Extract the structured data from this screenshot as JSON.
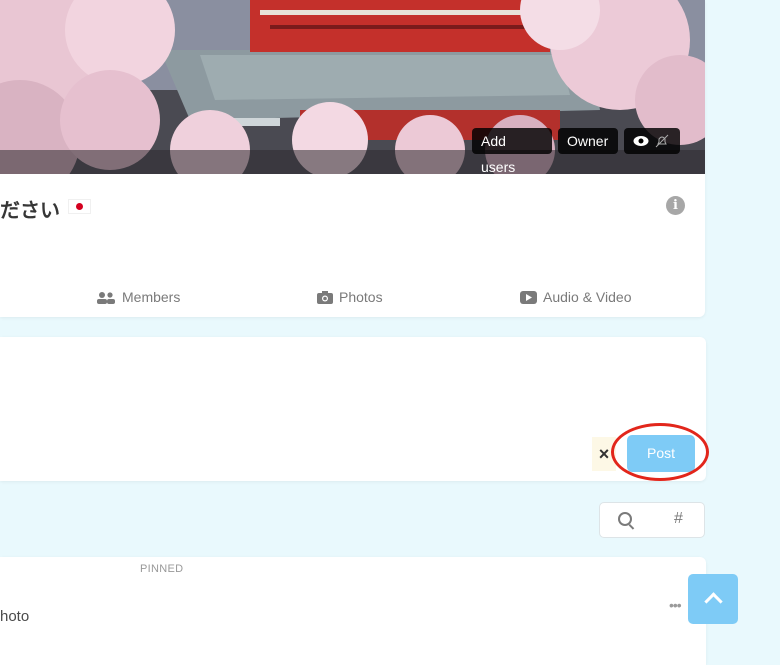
{
  "cover": {
    "buttons": {
      "add_users": "Add users",
      "owner": "Owner"
    },
    "icons": [
      "eye-icon",
      "bell-muted-icon"
    ]
  },
  "group": {
    "title_fragment": "ださい",
    "flag": "jp-flag-icon"
  },
  "tabs": [
    {
      "label": "Members",
      "icon": "users-icon"
    },
    {
      "label": "Photos",
      "icon": "camera-icon"
    },
    {
      "label": "Audio & Video",
      "icon": "play-icon"
    }
  ],
  "composer": {
    "cancel_label": "×",
    "post_label": "Post"
  },
  "search": {
    "search_icon": "search-icon",
    "hashtag_label": "#"
  },
  "feed": {
    "pinned_label": "PINNED",
    "post_text_fragment": "hoto",
    "more_label": "•••"
  },
  "colors": {
    "accent": "#7ecbf6",
    "background": "#e9f9fd",
    "highlight": "#e2261b"
  }
}
